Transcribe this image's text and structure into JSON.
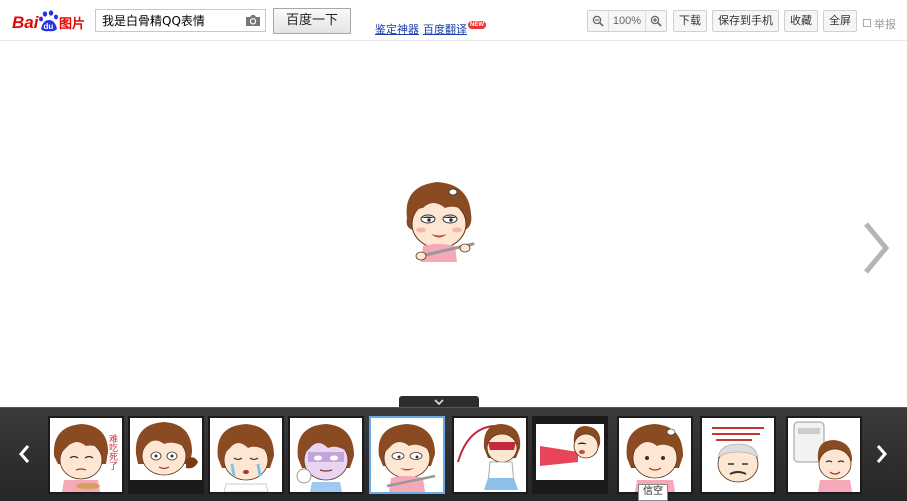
{
  "logo": {
    "text_bai": "Bai",
    "text_du": "du",
    "text_pic": "图片"
  },
  "search": {
    "value": "我是白骨精QQ表情",
    "button_label": "百度一下"
  },
  "links": {
    "item1": "鉴定神器",
    "item2": "百度翻译",
    "badge": "NEW"
  },
  "toolbar": {
    "zoom_level": "100%",
    "download_label": "下载",
    "save_to_phone_label": "保存到手机",
    "favorite_label": "收藏",
    "fullscreen_label": "全屏",
    "report_label": "举报"
  },
  "thumbnails": {
    "t0": {
      "caption": "难吃死了"
    },
    "t9": {
      "caption": ""
    }
  },
  "tooltip": {
    "text": "信空"
  },
  "colors": {
    "brand_red": "#e10602",
    "brand_blue": "#2932e1",
    "selected_border": "#6aaae8"
  }
}
